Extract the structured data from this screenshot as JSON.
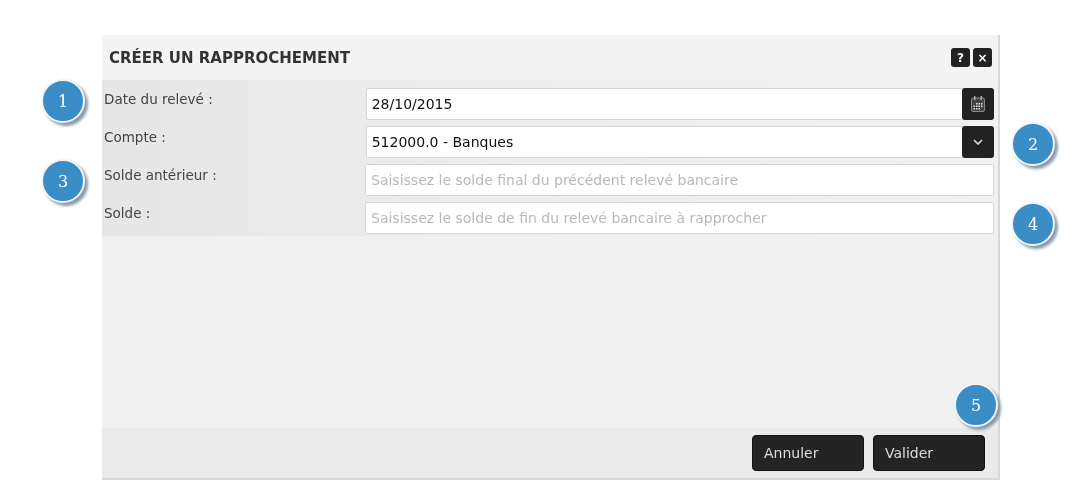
{
  "dialog": {
    "title": "CRÉER UN RAPPROCHEMENT",
    "help_button": "?",
    "close_button": "×"
  },
  "fields": [
    {
      "label": "Date du relevé :",
      "kind": "date",
      "value": "28/10/2015"
    },
    {
      "label": "Compte :",
      "kind": "select",
      "value": "512000.0 - Banques"
    },
    {
      "label": "Solde antérieur :",
      "kind": "text",
      "placeholder": "Saisissez le solde final du précédent relevé bancaire"
    },
    {
      "label": "Solde :",
      "kind": "text",
      "placeholder": "Saisissez le solde de fin du relevé bancaire à rapprocher"
    }
  ],
  "buttons": [
    "Annuler",
    "Valider"
  ],
  "callouts": [
    "1",
    "2",
    "3",
    "4",
    "5"
  ]
}
